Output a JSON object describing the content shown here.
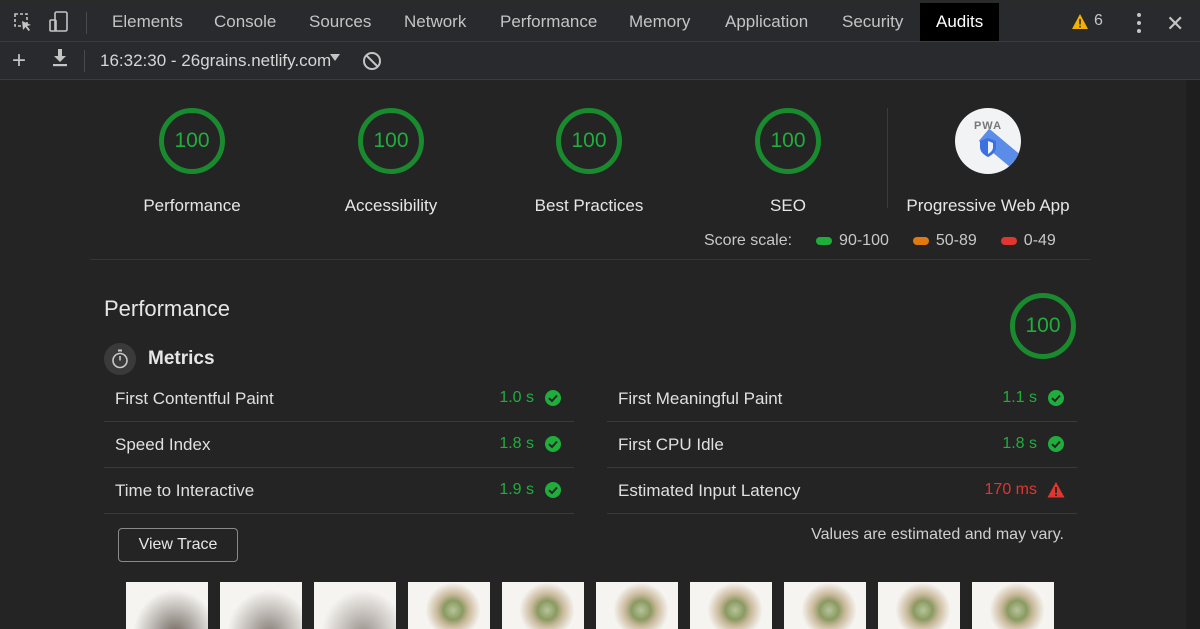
{
  "tabs": [
    "Elements",
    "Console",
    "Sources",
    "Network",
    "Performance",
    "Memory",
    "Application",
    "Security",
    "Audits"
  ],
  "active_tab": "Audits",
  "warnings": {
    "count": "6"
  },
  "toolbar": {
    "report_label": "16:32:30 - 26grains.netlify.com"
  },
  "categories": [
    {
      "score": "100",
      "label": "Performance"
    },
    {
      "score": "100",
      "label": "Accessibility"
    },
    {
      "score": "100",
      "label": "Best Practices"
    },
    {
      "score": "100",
      "label": "SEO"
    }
  ],
  "pwa": {
    "badge_text": "PWA",
    "label": "Progressive Web App"
  },
  "score_scale": {
    "label": "Score scale:",
    "ranges": [
      {
        "text": "90-100",
        "color": "#1fae3c"
      },
      {
        "text": "50-89",
        "color": "#e07a10"
      },
      {
        "text": "0-49",
        "color": "#e0362f"
      }
    ]
  },
  "performance": {
    "title": "Performance",
    "score": "100",
    "metrics_title": "Metrics"
  },
  "metrics": [
    {
      "name": "First Contentful Paint",
      "value": "1.0 s",
      "status": "pass"
    },
    {
      "name": "First Meaningful Paint",
      "value": "1.1 s",
      "status": "pass"
    },
    {
      "name": "Speed Index",
      "value": "1.8 s",
      "status": "pass"
    },
    {
      "name": "First CPU Idle",
      "value": "1.8 s",
      "status": "pass"
    },
    {
      "name": "Time to Interactive",
      "value": "1.9 s",
      "status": "pass"
    },
    {
      "name": "Estimated Input Latency",
      "value": "170 ms",
      "status": "fail"
    }
  ],
  "view_trace_label": "View Trace",
  "estimate_note": "Values are estimated and may vary.",
  "filmstrip_count": 10
}
